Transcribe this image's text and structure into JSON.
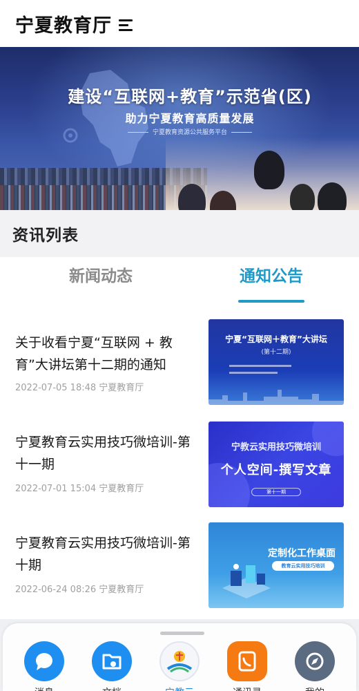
{
  "header": {
    "title": "宁夏教育厅",
    "menu_icon": "menu-icon"
  },
  "banner": {
    "title": "建设“互联网+教育”示范省(区)",
    "subtitle": "助力宁夏教育高质量发展",
    "small_text": "宁夏教育资源公共服务平台"
  },
  "section": {
    "title": "资讯列表"
  },
  "tabs": [
    {
      "label": "新闻动态",
      "active": false
    },
    {
      "label": "通知公告",
      "active": true
    }
  ],
  "news": [
    {
      "title": "关于收看宁夏“互联网 + 教育”大讲坛第十二期的通知",
      "date": "2022-07-05 18:48",
      "source": "宁夏教育厅",
      "thumb": {
        "title": "宁夏“互联网＋教育”大讲坛",
        "subtitle": "(第十二期)"
      }
    },
    {
      "title": "宁夏教育云实用技巧微培训-第十一期",
      "date": "2022-07-01 15:04",
      "source": "宁夏教育厅",
      "thumb": {
        "title": "宁教云实用技巧微培训",
        "big": "个人空间-撰写文章",
        "pill": "第十一期"
      }
    },
    {
      "title": "宁夏教育云实用技巧微培训-第十期",
      "date": "2022-06-24 08:26",
      "source": "宁夏教育厅",
      "thumb": {
        "title": "定制化工作桌面",
        "pill": "教育云实用技巧培训"
      }
    }
  ],
  "tabbar": [
    {
      "label": "消息",
      "icon": "chat-bubble-icon",
      "color": "#1e8ff0"
    },
    {
      "label": "文档",
      "icon": "folder-cloud-icon",
      "color": "#1e8ff0"
    },
    {
      "label": "宁教云",
      "icon": "ningjiaoyun-logo-icon",
      "color": "#1f86d8",
      "active": true
    },
    {
      "label": "通讯录",
      "icon": "contacts-phone-icon",
      "color": "#f57a12"
    },
    {
      "label": "我的",
      "icon": "compass-icon",
      "color": "#5b6b82"
    }
  ]
}
